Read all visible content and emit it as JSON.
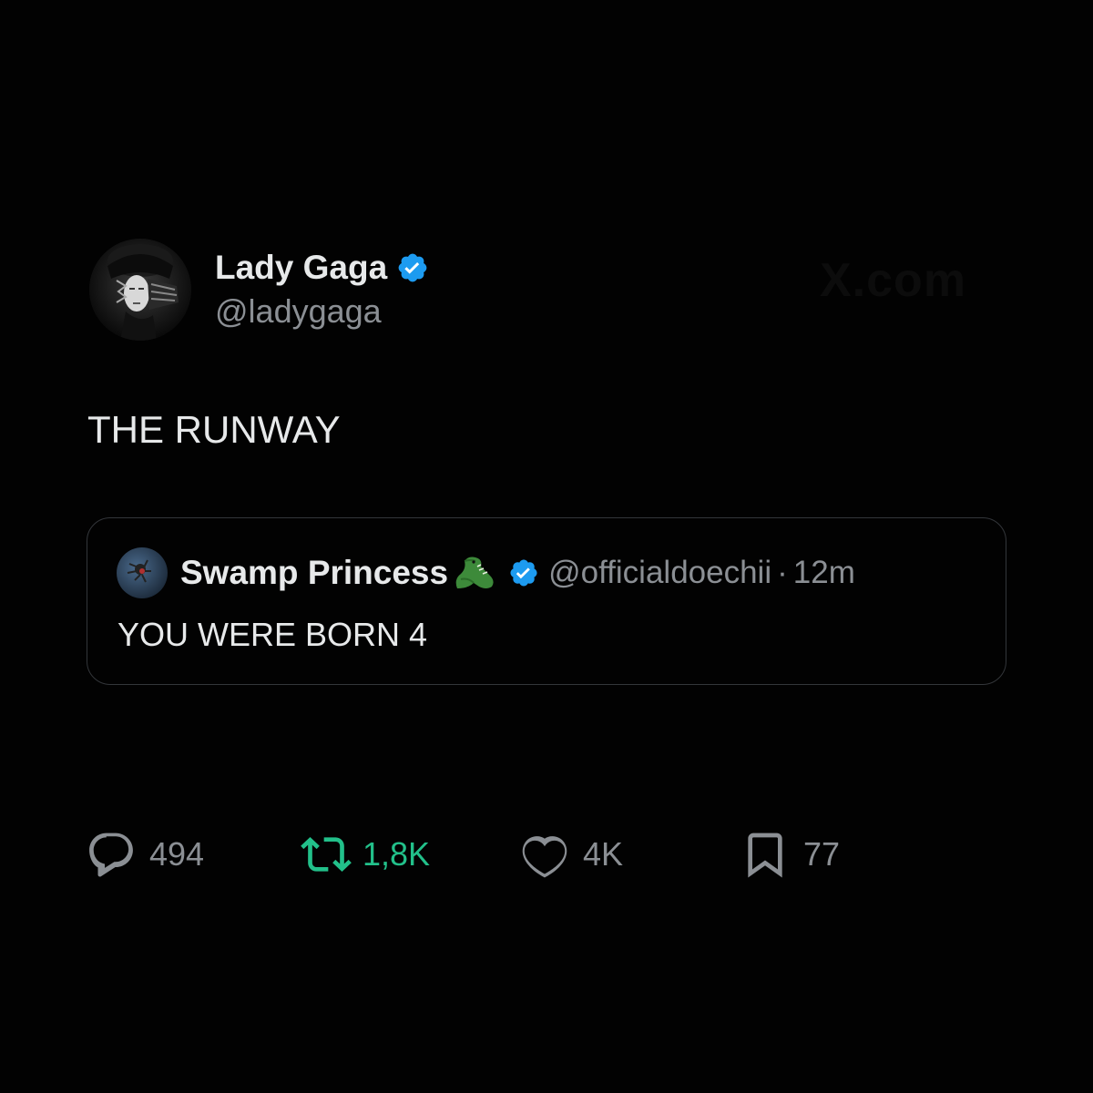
{
  "tweet": {
    "author": {
      "display_name": "Lady Gaga",
      "handle": "@ladygaga",
      "verified": true
    },
    "text": "THE RUNWAY",
    "watermark": "X.com",
    "quote": {
      "display_name": "Swamp Princess",
      "name_emoji": "crocodile-icon",
      "handle": "@officialdoechii",
      "separator": "·",
      "time": "12m",
      "text": "YOU WERE BORN 4",
      "verified": true
    },
    "metrics": {
      "replies": "494",
      "retweets": "1,8K",
      "likes": "4K",
      "bookmarks": "77"
    }
  },
  "colors": {
    "background": "#020202",
    "text_primary": "#e7e9ea",
    "text_secondary": "#8b8f94",
    "verified_blue": "#1d9bf0",
    "retweet_green": "#22c08a",
    "card_border": "#33363a"
  },
  "icons": {
    "reply": "speech-bubble-icon",
    "retweet": "retweet-arrows-icon",
    "like": "heart-icon",
    "bookmark": "bookmark-icon",
    "verified": "verified-badge-icon"
  }
}
